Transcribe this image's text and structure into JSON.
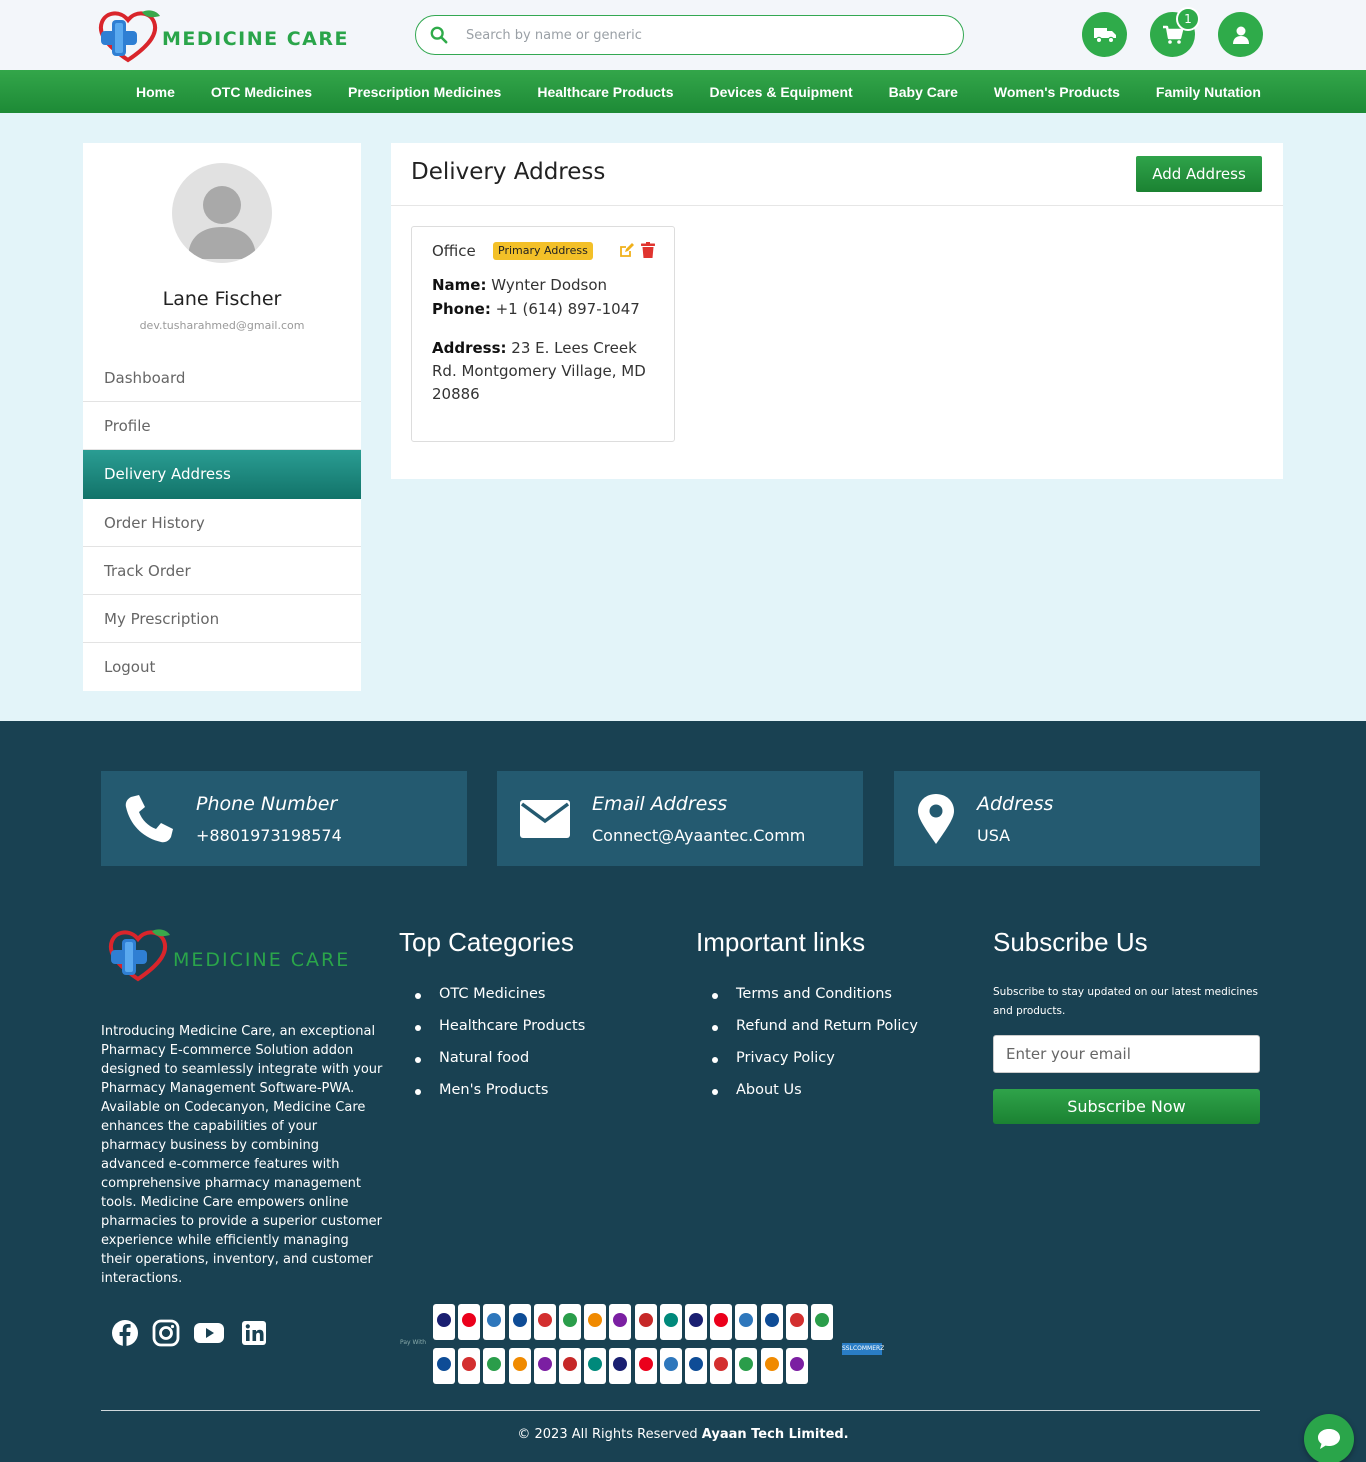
{
  "brand": {
    "name": "MEDICINE CARE"
  },
  "search": {
    "placeholder": "Search by name or generic"
  },
  "header": {
    "cart_count": "1"
  },
  "nav": {
    "items": [
      "Home",
      "OTC Medicines",
      "Prescription Medicines",
      "Healthcare Products",
      "Devices & Equipment",
      "Baby Care",
      "Women's Products",
      "Family Nutation"
    ]
  },
  "user": {
    "name": "Lane Fischer",
    "email": "dev.tusharahmed@gmail.com"
  },
  "sidebar": {
    "items": [
      {
        "label": "Dashboard"
      },
      {
        "label": "Profile"
      },
      {
        "label": "Delivery Address"
      },
      {
        "label": "Order History"
      },
      {
        "label": "Track Order"
      },
      {
        "label": "My Prescription"
      },
      {
        "label": "Logout"
      }
    ],
    "active": "Delivery Address"
  },
  "main": {
    "title": "Delivery Address",
    "add_button": "Add Address",
    "address": {
      "type": "Office",
      "badge": "Primary Address",
      "name_label": "Name:",
      "name": "Wynter Dodson",
      "phone_label": "Phone:",
      "phone": "+1 (614) 897-1047",
      "address_label": "Address:",
      "address": "23 E. Lees Creek Rd. Montgomery Village, MD 20886"
    }
  },
  "footer": {
    "contacts": [
      {
        "title": "Phone Number",
        "value": "+8801973198574",
        "icon": "phone-icon"
      },
      {
        "title": "Email Address",
        "value": "Connect@Ayaantec.Comm",
        "icon": "envelope-icon"
      },
      {
        "title": "Address",
        "value": "USA",
        "icon": "map-pin-icon"
      }
    ],
    "brand": "MEDICINE CARE",
    "description": "Introducing Medicine Care, an exceptional Pharmacy E-commerce Solution addon designed to seamlessly integrate with your Pharmacy Management Software-PWA. Available on Codecanyon, Medicine Care enhances the capabilities of your pharmacy business by combining advanced e-commerce features with comprehensive pharmacy management tools. Medicine Care empowers online pharmacies to provide a superior customer experience while efficiently managing their operations, inventory, and customer interactions.",
    "top_categories": {
      "title": "Top Categories",
      "items": [
        "OTC Medicines",
        "Healthcare Products",
        "Natural food",
        "Men's Products"
      ]
    },
    "important_links": {
      "title": "Important links",
      "items": [
        "Terms and Conditions",
        "Refund and Return Policy",
        "Privacy Policy",
        "About Us"
      ]
    },
    "subscribe": {
      "title": "Subscribe Us",
      "text": "Subscribe to stay updated on our latest medicines and products.",
      "placeholder": "Enter your email",
      "button": "Subscribe Now"
    },
    "payment": {
      "pay_with": "Pay With",
      "provider": "SSLCOMMERZ"
    },
    "copyright_prefix": "2023 All Rights Reserved",
    "copyright_company": "Ayaan Tech Limited."
  },
  "colors": {
    "brand_green": "#2fab4a",
    "footer_bg": "#194152",
    "contact_box": "#245a70",
    "active_teal": "#127369",
    "badge_yellow": "#f3c028",
    "delete_red": "#e0342f"
  }
}
